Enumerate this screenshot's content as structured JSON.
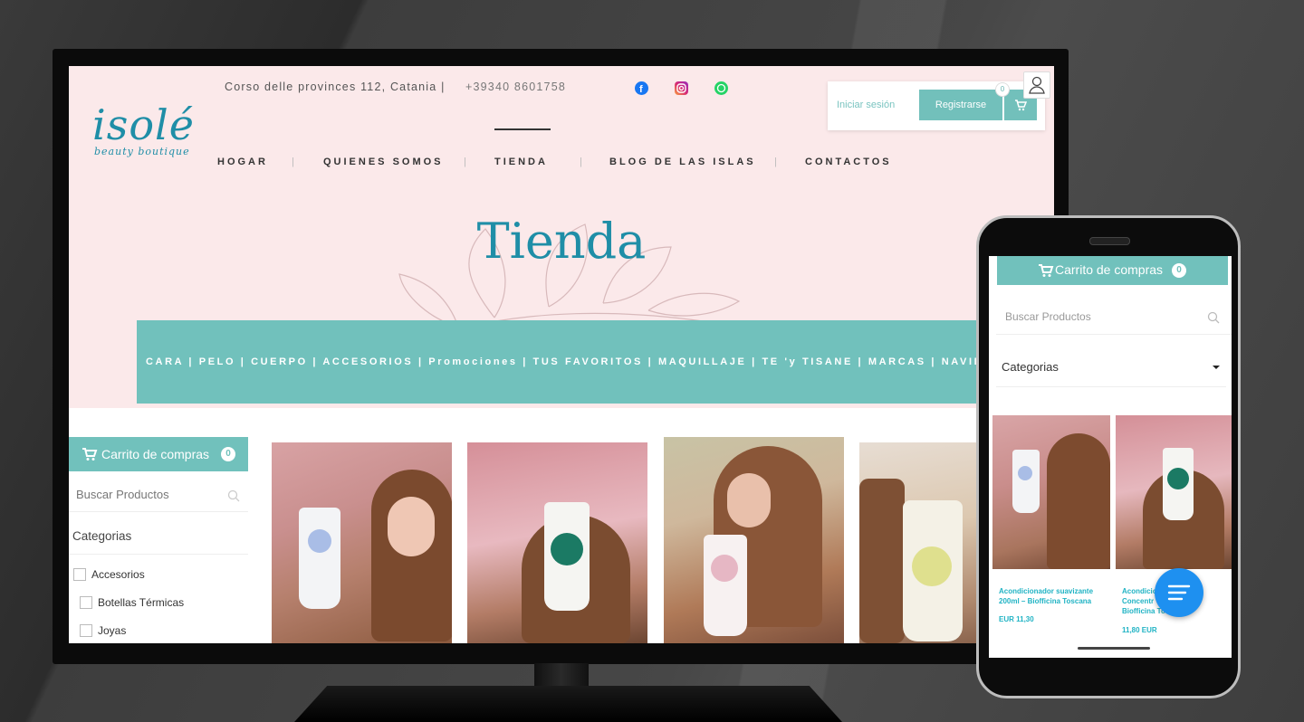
{
  "site": {
    "logo_main": "isolé",
    "logo_sub": "beauty boutique",
    "address": "Corso delle provinces 112, Catania |",
    "phone": "+39340 8601758",
    "login": "Iniciar sesión",
    "register": "Registrarse",
    "cart_count": "0"
  },
  "nav": [
    "HOGAR",
    "QUIENES SOMOS",
    "TIENDA",
    "BLOG DE LAS ISLAS",
    "CONTACTOS"
  ],
  "page_title": "Tienda",
  "categories_bar": "CARA | PELO | CUERPO | ACCESORIOS | Promociones | TUS FAVORITOS | MAQUILLAJE | TE 'y TISANE | MARCAS | NAVIDAD",
  "sidebar": {
    "cart_label": "Carrito de compras",
    "cart_count": "0",
    "search_placeholder": "Buscar Productos",
    "categories_title": "Categorias",
    "items": [
      "Accesorios",
      "Botellas Térmicas",
      "Joyas"
    ]
  },
  "mobile": {
    "cart_label": "Carrito de compras",
    "cart_count": "0",
    "search_placeholder": "Buscar Productos",
    "categories_label": "Categorias",
    "products": [
      {
        "name_line1": "Acondicionador suavizante",
        "name_line2": "200ml – Biofficina Toscana",
        "price": "EUR 11,30"
      },
      {
        "name_line1": "Acondicio",
        "name_line2": "Concentr",
        "name_line3": "Biofficina Tos",
        "price": "11,80 EUR"
      }
    ]
  },
  "colors": {
    "teal": "#71c1bc",
    "brand_blue": "#1f8ea7",
    "hero_pink": "#fbe9ea",
    "fab_blue": "#1e90f0"
  }
}
